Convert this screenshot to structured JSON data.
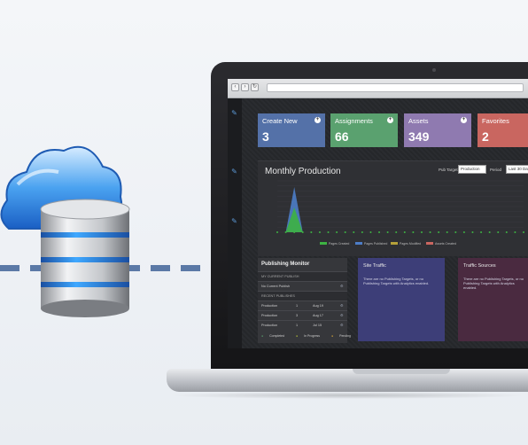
{
  "colors": {
    "tile_create": "#5471a8",
    "tile_assignments": "#5aa16f",
    "tile_assets": "#8f7ab0",
    "tile_favorites": "#c96660",
    "chart_fill_blue": "#4d7dc7",
    "chart_fill_green": "#3db342",
    "site_traffic_bg": "#3d3e78",
    "traffic_sources_bg": "#4a2a40"
  },
  "tiles": [
    {
      "label": "Create New",
      "value": "3"
    },
    {
      "label": "Assignments",
      "value": "66"
    },
    {
      "label": "Assets",
      "value": "349"
    },
    {
      "label": "Favorites",
      "value": "2"
    }
  ],
  "production": {
    "title": "Monthly Production",
    "pub_target_label": "Pub Target",
    "pub_target_value": "Production",
    "period_label": "Period",
    "period_value": "Last 30 Days",
    "legend": [
      "Pages Created",
      "Pages Published",
      "Pages Modified",
      "Assets Created"
    ]
  },
  "chart_data": {
    "type": "area",
    "series": [
      {
        "name": "Pages Created",
        "values": [
          0,
          0,
          44,
          0,
          0,
          0,
          0,
          0,
          0,
          0,
          0,
          0,
          0,
          0,
          0,
          0,
          0,
          0,
          0,
          0,
          0,
          0,
          0,
          0,
          0,
          0,
          0,
          0,
          0,
          0
        ]
      },
      {
        "name": "Pages Published",
        "values": [
          0,
          0,
          24,
          0,
          0,
          0,
          0,
          0,
          0,
          0,
          0,
          0,
          0,
          0,
          0,
          0,
          0,
          0,
          0,
          0,
          0,
          0,
          0,
          0,
          0,
          0,
          0,
          0,
          0,
          0
        ]
      }
    ],
    "ylim": [
      0,
      50
    ],
    "grid": true
  },
  "monitor": {
    "title": "Publishing Monitor",
    "my_current_label": "MY CURRENT PUBLISH",
    "no_current": "No Current Publish",
    "recent_label": "RECENT PUBLISHES",
    "rows": [
      {
        "target": "Production",
        "count": "1",
        "date": "Aug 19"
      },
      {
        "target": "Production",
        "count": "3",
        "date": "Aug 17"
      },
      {
        "target": "Production",
        "count": "1",
        "date": "Jul 15"
      }
    ],
    "status_legend": [
      "Completed",
      "In Progress",
      "Pending"
    ]
  },
  "site_traffic": {
    "title": "Site Traffic",
    "message": "There are no Publishing Targets, or no Publishing Targets with Analytics enabled."
  },
  "traffic_sources": {
    "title": "Traffic Sources",
    "message": "There are no Publishing Targets, or no Publishing Targets with Analytics enabled."
  }
}
